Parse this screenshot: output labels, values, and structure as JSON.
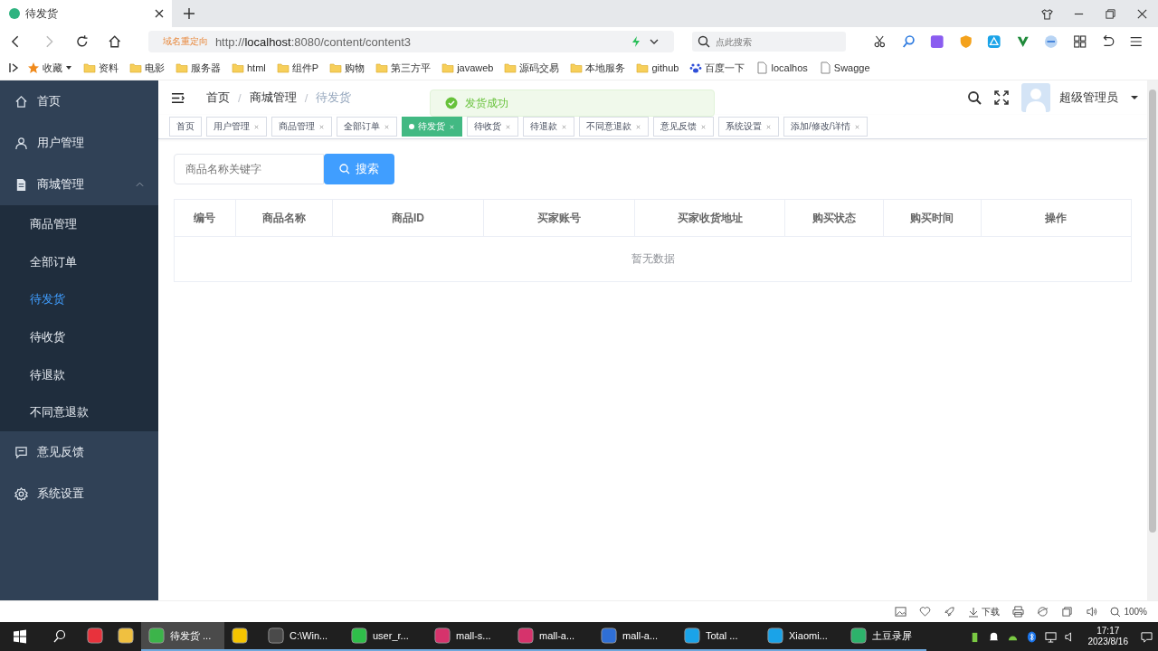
{
  "browser": {
    "tab_title": "待发货",
    "url_badge": "域名重定向",
    "url": "http://**localhost**:8080/content/content3",
    "search_placeholder": "点此搜索",
    "bookmarks": [
      {
        "label": "收藏",
        "kind": "star"
      },
      {
        "label": "资料",
        "kind": "folder"
      },
      {
        "label": "电影",
        "kind": "folder"
      },
      {
        "label": "服务器",
        "kind": "folder"
      },
      {
        "label": "html",
        "kind": "folder"
      },
      {
        "label": "组件P",
        "kind": "folder"
      },
      {
        "label": "购物",
        "kind": "folder"
      },
      {
        "label": "第三方平",
        "kind": "folder"
      },
      {
        "label": "javaweb",
        "kind": "folder"
      },
      {
        "label": "源码交易",
        "kind": "folder"
      },
      {
        "label": "本地服务",
        "kind": "folder"
      },
      {
        "label": "github",
        "kind": "folder"
      },
      {
        "label": "百度一下",
        "kind": "paw"
      },
      {
        "label": "localhos",
        "kind": "page"
      },
      {
        "label": "Swagge",
        "kind": "page"
      }
    ]
  },
  "sidebar": {
    "items": [
      {
        "label": "首页",
        "kind": "home",
        "selected": false
      },
      {
        "label": "用户管理",
        "kind": "user",
        "selected": false
      },
      {
        "label": "商城管理",
        "kind": "doc",
        "selected": false,
        "expanded": true,
        "children": [
          {
            "label": "商品管理",
            "selected": false
          },
          {
            "label": "全部订单",
            "selected": false
          },
          {
            "label": "待发货",
            "selected": true
          },
          {
            "label": "待收货",
            "selected": false
          },
          {
            "label": "待退款",
            "selected": false
          },
          {
            "label": "不同意退款",
            "selected": false
          }
        ]
      },
      {
        "label": "意见反馈",
        "kind": "chat",
        "selected": false
      },
      {
        "label": "系统设置",
        "kind": "gear",
        "selected": false
      }
    ]
  },
  "header": {
    "breadcrumb": [
      {
        "label": "首页"
      },
      {
        "separator": "/",
        "label": "商城管理"
      },
      {
        "separator": "/",
        "label": "待发货"
      }
    ],
    "user": "超级管理员"
  },
  "tags": [
    {
      "label": "首页",
      "closable": false,
      "selected": false
    },
    {
      "label": "用户管理",
      "closable": true,
      "selected": false
    },
    {
      "label": "商品管理",
      "closable": true,
      "selected": false
    },
    {
      "label": "全部订单",
      "closable": true,
      "selected": false
    },
    {
      "label": "待发货",
      "closable": true,
      "selected": true
    },
    {
      "label": "待收货",
      "closable": true,
      "selected": false
    },
    {
      "label": "待退款",
      "closable": true,
      "selected": false
    },
    {
      "label": "不同意退款",
      "closable": true,
      "selected": false
    },
    {
      "label": "意见反馈",
      "closable": true,
      "selected": false
    },
    {
      "label": "系统设置",
      "closable": true,
      "selected": false
    },
    {
      "label": "添加/修改/详情",
      "closable": true,
      "selected": false
    }
  ],
  "toast": {
    "text": "发货成功"
  },
  "search": {
    "placeholder": "商品名称关键字",
    "button": "搜索"
  },
  "table": {
    "columns": [
      "编号",
      "商品名称",
      "商品ID",
      "买家账号",
      "买家收货地址",
      "购买状态",
      "购买时间",
      "操作"
    ],
    "empty_text": "暂无数据"
  },
  "status_bar": {
    "download": "下载",
    "zoom": "100%"
  },
  "taskbar": {
    "apps": [
      {
        "color": "#e8323c"
      },
      {
        "color": "#f0c040"
      },
      {
        "label": "待发货 ...",
        "color": "#3cb44a",
        "selected": true
      },
      {
        "color": "#f5c400",
        "selected": false
      },
      {
        "label": "C:\\Win...",
        "color": "#4a4a4a",
        "selected": false
      },
      {
        "label": "user_r...",
        "color": "#2fbf4a",
        "selected": false
      },
      {
        "label": "mall-s...",
        "color": "#d6336c",
        "selected": false
      },
      {
        "label": "mall-a...",
        "color": "#d6336c",
        "selected": false
      },
      {
        "label": "mall-a...",
        "color": "#2f6fd6",
        "selected": false
      },
      {
        "label": "Total ...",
        "color": "#1aa3e8",
        "selected": false
      },
      {
        "label": "Xiaomi...",
        "color": "#1aa3e8",
        "selected": false
      },
      {
        "label": "土豆录屏",
        "color": "#2db36b",
        "selected": false
      }
    ],
    "time": "17:17",
    "date": "2023/8/16"
  }
}
